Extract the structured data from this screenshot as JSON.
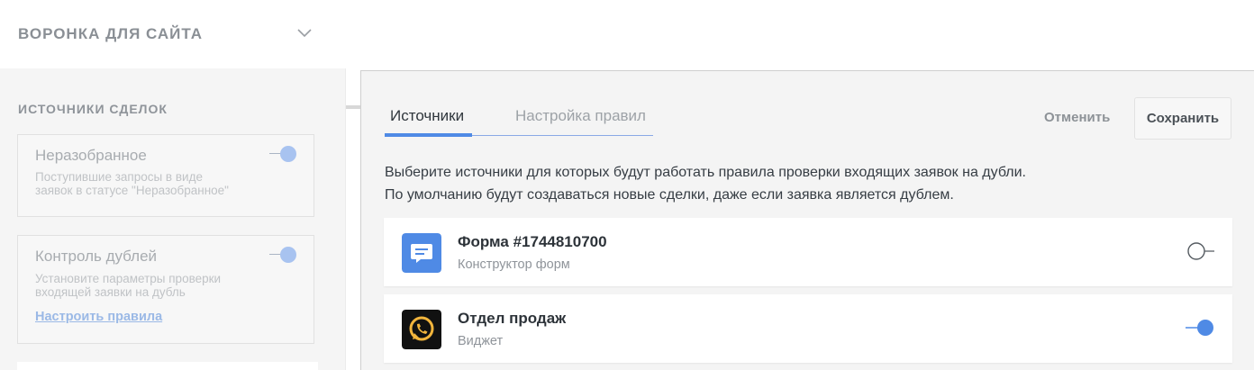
{
  "sidebar": {
    "pipeline_title": "ВОРОНКА ДЛЯ САЙТА",
    "section_title": "ИСТОЧНИКИ СДЕЛОК",
    "cards": [
      {
        "title": "Неразобранное",
        "description_lines": [
          "Поступившие запросы в виде",
          "заявок в статусе \"Неразобранное\""
        ],
        "enabled": true
      },
      {
        "title": "Контроль дублей",
        "description_lines": [
          "Установите параметры проверки",
          "входящей заявки на дубль"
        ],
        "link": "Настроить правила",
        "enabled": true
      }
    ]
  },
  "modal": {
    "tabs": [
      {
        "label": "Источники",
        "active": true
      },
      {
        "label": "Настройка правил",
        "active": false
      }
    ],
    "cancel_label": "Отменить",
    "save_label": "Сохранить",
    "description_lines": [
      "Выберите источники для которых будут работать правила проверки входящих заявок на дубли.",
      "По умолчанию будут создаваться новые сделки, даже если заявка является дублем."
    ],
    "sources": [
      {
        "name": "Форма #1744810700",
        "type": "Конструктор форм",
        "icon": "form-chat-icon",
        "icon_color": "#4f8ae5",
        "enabled": false
      },
      {
        "name": "Отдел продаж",
        "type": "Виджет",
        "icon": "whatsapp-icon",
        "icon_color": "#f2b53c",
        "enabled": true
      }
    ]
  },
  "colors": {
    "accent": "#4f8ae5",
    "toggle_on_light": "#a8c3f0"
  }
}
